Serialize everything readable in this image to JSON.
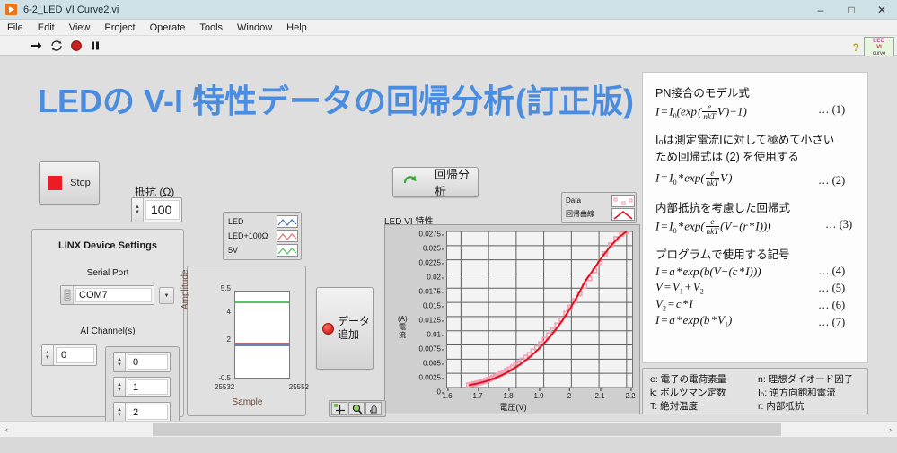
{
  "window": {
    "title": "6-2_LED VI Curve2.vi",
    "app_icon": "labview-run-icon",
    "minimize": "–",
    "maximize": "□",
    "close": "✕"
  },
  "menu": [
    "File",
    "Edit",
    "View",
    "Project",
    "Operate",
    "Tools",
    "Window",
    "Help"
  ],
  "toolbar": {
    "icons": [
      "run-arrow-icon",
      "run-continuously-icon",
      "abort-execution-icon",
      "pause-icon"
    ],
    "help_glyph": "?",
    "vi_icon": {
      "line1": "LED",
      "line2": "VI",
      "line3": "curve",
      "badge": "2"
    }
  },
  "panel": {
    "title": "LEDの V-I 特性データの回帰分析(訂正版)",
    "title_color": "#4a8de0"
  },
  "stop_button": {
    "label": "Stop",
    "indicator_color": "#ec1c24"
  },
  "resistance": {
    "label": "抵抗 (Ω)",
    "value": "100"
  },
  "linx": {
    "title": "LINX Device Settings",
    "serial_port_label": "Serial Port",
    "serial_port_value": "COM7",
    "ai_channels_label": "AI Channel(s)",
    "index_value": "0",
    "channels": [
      "0",
      "1",
      "2"
    ]
  },
  "waveform": {
    "legend": [
      {
        "name": "LED",
        "color": "#3a6fb5"
      },
      {
        "name": "LED+100Ω",
        "color": "#e06a6a"
      },
      {
        "name": "5V",
        "color": "#44c050"
      }
    ],
    "ylabel": "Amplitude",
    "xlabel": "Sample",
    "yticks": [
      "5.5",
      "4",
      "2",
      "-0.5"
    ],
    "xticks": [
      "25532",
      "25552"
    ]
  },
  "regression_button": {
    "label": "回帰分析",
    "icon": "green-arrow-icon"
  },
  "add_data_button": {
    "label_line1": "データ",
    "label_line2": "追加",
    "indicator_color": "#d2241c"
  },
  "graph_legend": [
    {
      "name": "Data",
      "style": "scatter",
      "color": "#f4a0b4"
    },
    {
      "name": "回帰曲線",
      "style": "line",
      "color": "#e01020"
    }
  ],
  "graph_palette": [
    "cursor-crosshair-icon",
    "zoom-magnifier-icon",
    "pan-hand-icon"
  ],
  "chart_data": {
    "type": "scatter",
    "title": "LED VI 特性",
    "xlabel": "電圧(V)",
    "ylabel": "電流 (A)",
    "xlim": [
      1.55,
      2.22
    ],
    "ylim": [
      0,
      0.0275
    ],
    "grid": true,
    "xticks": [
      "1.6",
      "1.7",
      "1.8",
      "1.9",
      "2",
      "2.1",
      "2.2"
    ],
    "yticks": [
      "0.0275",
      "0.025",
      "0.0225",
      "0.02",
      "0.0175",
      "0.015",
      "0.0125",
      "0.01",
      "0.0075",
      "0.005",
      "0.0025",
      "0"
    ],
    "legend_position": "top-right-outside",
    "series": [
      {
        "name": "Data",
        "style": "scatter",
        "color": "#f4a0b4",
        "x": [
          1.628,
          1.638,
          1.648,
          1.657,
          1.665,
          1.673,
          1.681,
          1.69,
          1.698,
          1.707,
          1.716,
          1.725,
          1.734,
          1.744,
          1.754,
          1.765,
          1.776,
          1.787,
          1.798,
          1.81,
          1.822,
          1.835,
          1.848,
          1.861,
          1.875,
          1.889,
          1.903,
          1.918,
          1.933,
          1.948,
          1.964,
          1.98,
          1.996,
          2.013,
          2.03,
          2.048,
          2.066,
          2.084,
          2.103,
          2.122,
          2.142,
          2.162,
          2.182,
          2.2
        ],
        "y": [
          0.00045,
          0.00055,
          0.00065,
          0.00075,
          0.00085,
          0.00095,
          0.0011,
          0.00125,
          0.0014,
          0.00155,
          0.00175,
          0.00195,
          0.00215,
          0.0024,
          0.00265,
          0.00295,
          0.00325,
          0.0036,
          0.00395,
          0.00435,
          0.0048,
          0.0053,
          0.0058,
          0.0064,
          0.007,
          0.0077,
          0.00845,
          0.00925,
          0.0101,
          0.011,
          0.012,
          0.01305,
          0.01415,
          0.0153,
          0.01655,
          0.01785,
          0.0192,
          0.0206,
          0.02205,
          0.02355,
          0.0251,
          0.0262,
          0.027,
          0.0275
        ]
      },
      {
        "name": "回帰曲線",
        "style": "line",
        "color": "#e01020",
        "x": [
          1.628,
          1.66,
          1.69,
          1.72,
          1.75,
          1.78,
          1.81,
          1.84,
          1.87,
          1.9,
          1.93,
          1.96,
          1.99,
          2.02,
          2.05,
          2.08,
          2.11,
          2.14,
          2.17,
          2.2
        ],
        "y": [
          0.00042,
          0.00072,
          0.0011,
          0.0016,
          0.00222,
          0.003,
          0.00392,
          0.005,
          0.00625,
          0.0077,
          0.00938,
          0.0113,
          0.01348,
          0.01595,
          0.01872,
          0.0208,
          0.0229,
          0.0248,
          0.0264,
          0.0275
        ]
      }
    ]
  },
  "formulas": [
    {
      "heading": "PN接合のモデル式",
      "equation_html": "I&#8202;=&#8202;I<span class=\"sub\">0</span>(exp&#8202;(<span class=\"frac\"><span class=\"num\">e</span><span class=\"den\">nkT</span></span>V&#8202;)&minus;1)",
      "number": "… (1)"
    },
    {
      "heading": "I₀は測定電流Iに対して極めて小さい",
      "heading2": "ため回帰式は (2) を使用する",
      "equation_html": "I&#8202;=&#8202;I<span class=\"sub\">0</span>&#8202;*&#8202;exp(<span class=\"frac\"><span class=\"num\">e</span><span class=\"den\">nkT</span></span>V&#8202;)",
      "number": "… (2)"
    },
    {
      "heading": "内部抵抗を考慮した回帰式",
      "equation_html": "I&#8202;=&#8202;I<span class=\"sub\">0</span>&#8202;*&#8202;exp(<span class=\"frac\"><span class=\"num\">e</span><span class=\"den\">nkT</span></span>(V&minus;(r&#8202;*&#8202;I)))",
      "number": "… (3)"
    },
    {
      "heading": "プログラムで使用する記号",
      "equation_html": "I&#8202;=&#8202;a&#8202;*&#8202;exp&#8202;(b(V&minus;(c&#8202;*&#8202;I)))",
      "number": "… (4)"
    },
    {
      "equation_html": "V&#8202;=&#8202;V<span class=\"sub\">1</span>&#8202;+&#8202;V<span class=\"sub\">2</span>",
      "number": "… (5)"
    },
    {
      "equation_html": "V<span class=\"sub\">2</span>&#8202;=&#8202;c&#8202;*&#8202;I",
      "number": "… (6)"
    },
    {
      "equation_html": "I&#8202;=&#8202;a&#8202;*&#8202;exp&#8202;(b&#8202;*&#8202;V<span class=\"sub\">1</span>)",
      "number": "… (7)"
    }
  ],
  "symbol_legend": {
    "left": [
      "e: 電子の電荷素量",
      "k: ボルツマン定数",
      "T: 絶対温度"
    ],
    "right": [
      "n: 理想ダイオード因子",
      "I₀: 逆方向飽和電流",
      "r: 内部抵抗"
    ]
  },
  "scrollbar": {
    "left_arrow": "‹",
    "right_arrow": "›"
  }
}
